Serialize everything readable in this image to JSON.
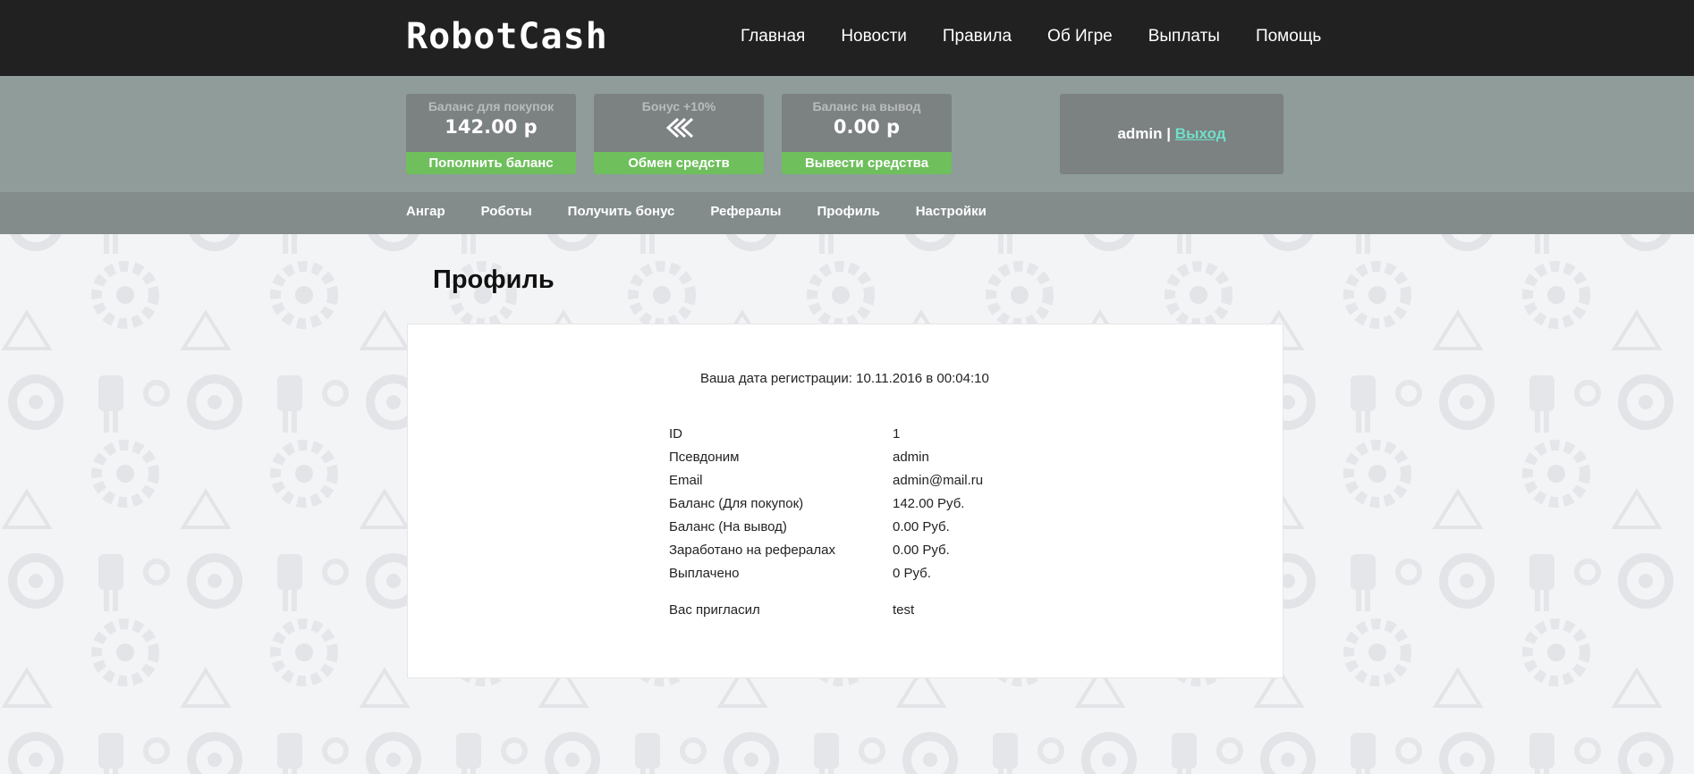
{
  "header": {
    "logo": "RobotCash",
    "nav": [
      "Главная",
      "Новости",
      "Правила",
      "Об Игре",
      "Выплаты",
      "Помощь"
    ]
  },
  "balances": {
    "purchase": {
      "label": "Баланс для покупок",
      "value": "142.00 р",
      "button": "Пополнить баланс"
    },
    "bonus": {
      "label": "Бонус +10%",
      "icon": "double-chevron-left-icon",
      "button": "Обмен средств"
    },
    "withdraw": {
      "label": "Баланс на вывод",
      "value": "0.00 р",
      "button": "Вывести средства"
    }
  },
  "user": {
    "name": "admin",
    "separator": "|",
    "logout": "Выход"
  },
  "subnav": [
    "Ангар",
    "Роботы",
    "Получить бонус",
    "Рефералы",
    "Профиль",
    "Настройки"
  ],
  "page": {
    "title": "Профиль",
    "registration": "Ваша дата регистрации: 10.11.2016 в 00:04:10",
    "rows": [
      {
        "key": "ID",
        "value": "1"
      },
      {
        "key": "Псевдоним",
        "value": "admin"
      },
      {
        "key": "Email",
        "value": "admin@mail.ru"
      },
      {
        "key": "Баланс (Для покупок)",
        "value": "142.00 Руб."
      },
      {
        "key": "Баланс (На вывод)",
        "value": "0.00 Руб."
      },
      {
        "key": "Заработано на рефералах",
        "value": "0.00 Руб."
      },
      {
        "key": "Выплачено",
        "value": "0 Руб."
      }
    ],
    "invited": {
      "key": "Вас пригласил",
      "value": "test"
    }
  },
  "colors": {
    "topbar": "#212121",
    "balancebar": "#8f9c9a",
    "card": "#7c8182",
    "accent_green": "#6fbf5d",
    "subnav": "#838c8b",
    "logout_link": "#6fe0c8"
  }
}
